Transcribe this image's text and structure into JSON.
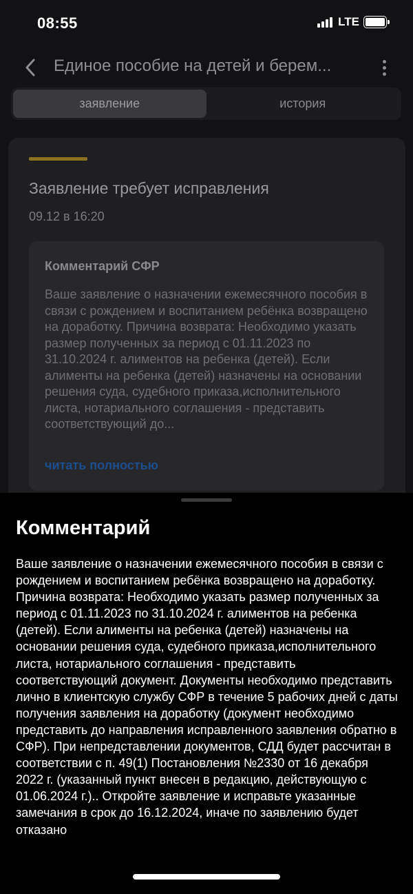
{
  "status_bar": {
    "time": "08:55",
    "network": "LTE",
    "icons": [
      "cellular-signal-icon",
      "battery-icon"
    ]
  },
  "header": {
    "title": "Единое пособие на детей и берем...",
    "icons": [
      "chevron-left-icon",
      "more-vertical-icon"
    ]
  },
  "tabs": [
    {
      "label": "заявление",
      "active": true
    },
    {
      "label": "история",
      "active": false
    }
  ],
  "card": {
    "accent_color": "#8a7320",
    "title": "Заявление требует исправления",
    "date": "09.12 в 16:20",
    "comment": {
      "title": "Комментарий СФР",
      "text": "Ваше заявление о назначении ежемесячного пособия в связи с рождением и воспитанием ребёнка возвращено на доработку. Причина возврата: Необходимо указать размер полученных за период с 01.11.2023 по 31.10.2024 г. алиментов на ребенка (детей). Если алименты на ребенка (детей) назначены на основании решения суда, судебного приказа,исполнительного листа, нотариального соглашения - представить соответствующий до...",
      "read_more": "читать полностью",
      "link_color": "#1b4d8f"
    }
  },
  "sheet": {
    "title": "Комментарий",
    "text": "Ваше заявление о назначении ежемесячного пособия в связи с рождением и воспитанием ребёнка возвращено на доработку. Причина возврата: Необходимо указать размер полученных за период с 01.11.2023 по 31.10.2024 г. алиментов на ребенка (детей). Если алименты на ребенка (детей) назначены на основании решения суда, судебного приказа,исполнительного листа, нотариального соглашения - представить соответствующий документ. Документы необходимо представить лично в клиентскую службу СФР в течение 5 рабочих дней с даты получения заявления на доработку (документ необходимо представить до направления исправленного заявления обратно в СФР). При непредставлении документов, СДД будет рассчитан в соответствии с п. 49(1) Постановления №2330 от 16 декабря 2022 г. (указанный пункт внесен в редакцию, действующую с 01.06.2024 г.).. Откройте заявление и исправьте указанные замечания в срок до 16.12.2024, иначе по заявлению будет отказано"
  }
}
